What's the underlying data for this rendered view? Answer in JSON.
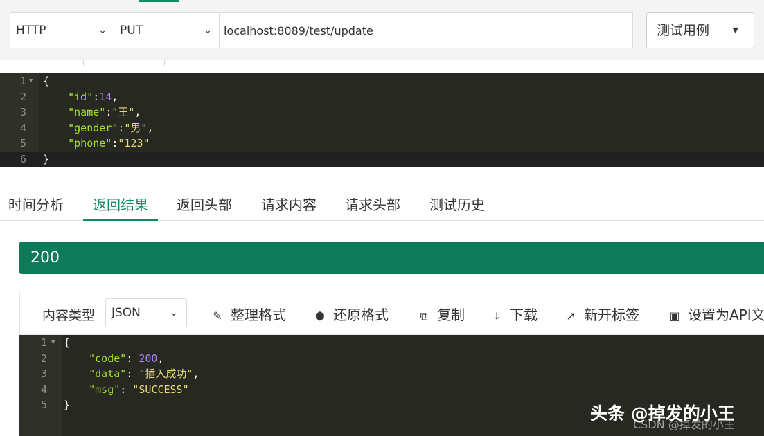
{
  "request": {
    "protocol": "HTTP",
    "method": "PUT",
    "url": "localhost:8089/test/update",
    "testcase_label": "测试用例"
  },
  "request_body": {
    "lines": [
      {
        "num": "1",
        "parts": [
          {
            "t": "{",
            "c": "p"
          }
        ]
      },
      {
        "num": "2",
        "parts": [
          {
            "t": "    ",
            "c": "p"
          },
          {
            "t": "\"id\"",
            "c": "k"
          },
          {
            "t": ":",
            "c": "p"
          },
          {
            "t": "14",
            "c": "n"
          },
          {
            "t": ",",
            "c": "p"
          }
        ]
      },
      {
        "num": "3",
        "parts": [
          {
            "t": "    ",
            "c": "p"
          },
          {
            "t": "\"name\"",
            "c": "k"
          },
          {
            "t": ":",
            "c": "p"
          },
          {
            "t": "\"王\"",
            "c": "s"
          },
          {
            "t": ",",
            "c": "p"
          }
        ]
      },
      {
        "num": "4",
        "parts": [
          {
            "t": "    ",
            "c": "p"
          },
          {
            "t": "\"gender\"",
            "c": "k"
          },
          {
            "t": ":",
            "c": "p"
          },
          {
            "t": "\"男\"",
            "c": "s"
          },
          {
            "t": ",",
            "c": "p"
          }
        ]
      },
      {
        "num": "5",
        "parts": [
          {
            "t": "    ",
            "c": "p"
          },
          {
            "t": "\"phone\"",
            "c": "k"
          },
          {
            "t": ":",
            "c": "p"
          },
          {
            "t": "\"123\"",
            "c": "s"
          }
        ]
      },
      {
        "num": "6",
        "parts": [
          {
            "t": "}",
            "c": "p"
          }
        ]
      }
    ]
  },
  "tabs": [
    "时间分析",
    "返回结果",
    "返回头部",
    "请求内容",
    "请求头部",
    "测试历史"
  ],
  "active_tab": "返回结果",
  "status_code": "200",
  "response_toolbar": {
    "content_type_label": "内容类型",
    "content_type_value": "JSON",
    "buttons": [
      "整理格式",
      "还原格式",
      "复制",
      "下载",
      "新开标签",
      "设置为API文"
    ]
  },
  "response_body": {
    "lines": [
      {
        "num": "1",
        "parts": [
          {
            "t": "{",
            "c": "p"
          }
        ]
      },
      {
        "num": "2",
        "parts": [
          {
            "t": "    ",
            "c": "p"
          },
          {
            "t": "\"code\"",
            "c": "k"
          },
          {
            "t": ": ",
            "c": "p"
          },
          {
            "t": "200",
            "c": "sn"
          },
          {
            "t": ",",
            "c": "p"
          }
        ]
      },
      {
        "num": "3",
        "parts": [
          {
            "t": "    ",
            "c": "p"
          },
          {
            "t": "\"data\"",
            "c": "k"
          },
          {
            "t": ": ",
            "c": "p"
          },
          {
            "t": "\"插入成功\"",
            "c": "s"
          },
          {
            "t": ",",
            "c": "p"
          }
        ]
      },
      {
        "num": "4",
        "parts": [
          {
            "t": "    ",
            "c": "p"
          },
          {
            "t": "\"msg\"",
            "c": "k"
          },
          {
            "t": ": ",
            "c": "p"
          },
          {
            "t": "\"SUCCESS\"",
            "c": "s"
          }
        ]
      },
      {
        "num": "5",
        "parts": [
          {
            "t": "}",
            "c": "p"
          }
        ]
      }
    ]
  },
  "watermark": {
    "main": "头条 @掉发的小王",
    "sub": "CSDN @掉发的小王"
  },
  "colors": {
    "accent": "#0f8a62",
    "status_bar": "#0d7a59",
    "editor_bg": "#272822"
  },
  "icons": [
    "chevron-down-icon",
    "magic-wand-icon",
    "cube-icon",
    "copy-icon",
    "download-icon",
    "external-link-icon",
    "save-icon"
  ]
}
